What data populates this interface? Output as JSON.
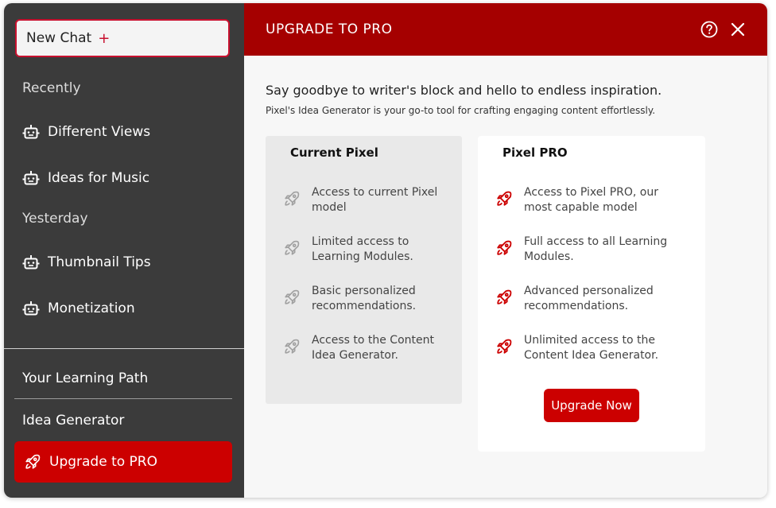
{
  "sidebar": {
    "new_chat_label": "New Chat",
    "new_chat_plus": "+",
    "sections": [
      {
        "label": "Recently",
        "items": [
          {
            "label": "Different Views",
            "icon": "robot-icon"
          },
          {
            "label": "Ideas for Music",
            "icon": "robot-icon"
          }
        ]
      },
      {
        "label": "Yesterday",
        "items": [
          {
            "label": "Thumbnail Tips",
            "icon": "robot-icon"
          },
          {
            "label": "Monetization",
            "icon": "robot-icon"
          }
        ]
      }
    ],
    "learning_path": "Your Learning Path",
    "idea_generator": "Idea Generator",
    "upgrade_label": "Upgrade to PRO"
  },
  "header": {
    "title": "UPGRADE TO PRO",
    "help_icon": "help-circle-icon",
    "close_icon": "close-icon"
  },
  "main": {
    "headline": "Say goodbye to writer's block and hello to endless inspiration.",
    "subline": "Pixel's Idea Generator is your go-to tool for crafting engaging content effortlessly.",
    "plans": {
      "current": {
        "title": "Current Pixel",
        "features": [
          "Access to current Pixel model",
          "Limited access to Learning Modules.",
          "Basic personalized recommendations.",
          "Access to the Content Idea Generator."
        ]
      },
      "pro": {
        "title": "Pixel PRO",
        "features": [
          "Access to Pixel PRO, our most capable model",
          "Full access to all Learning Modules.",
          "Advanced personalized recommendations.",
          "Unlimited access to the Content Idea Generator."
        ],
        "button_label": "Upgrade Now"
      }
    }
  },
  "colors": {
    "accent": "#cc0000",
    "header_bg": "#a50000",
    "sidebar_bg": "#3b3b3b",
    "muted_icon": "#a0a0a0"
  }
}
